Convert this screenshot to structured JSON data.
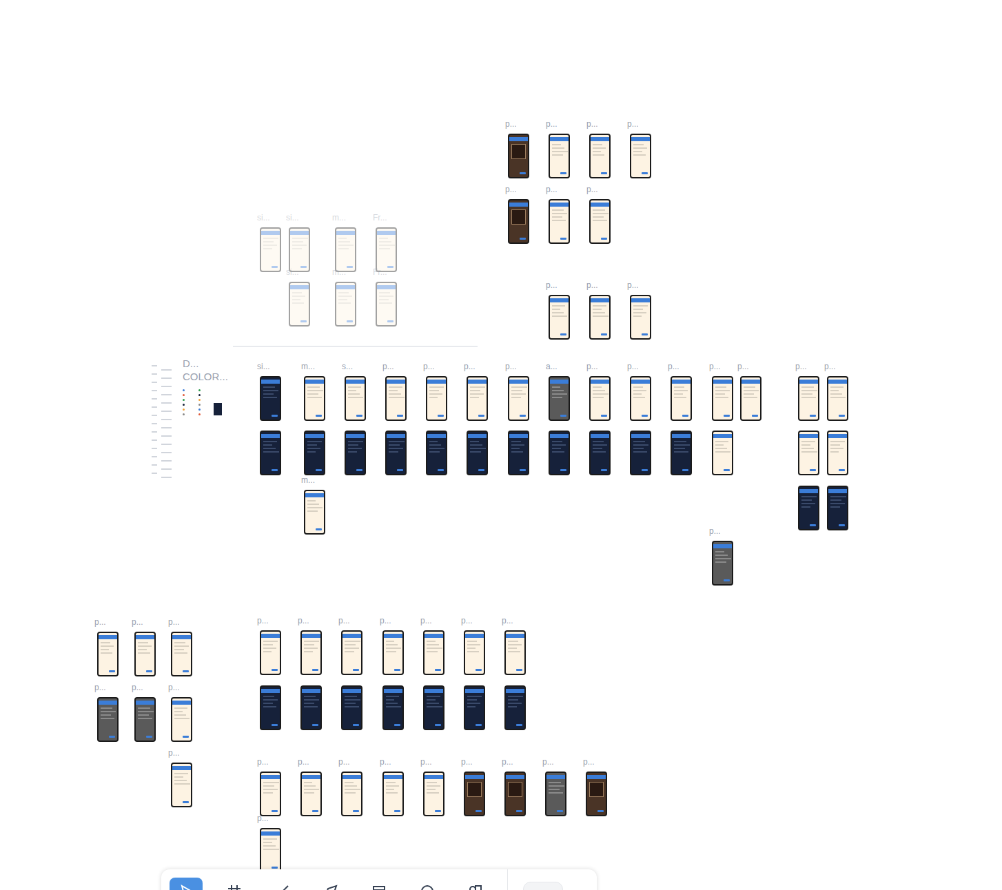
{
  "canvas": {
    "section_labels": [
      "D...",
      "COLOR..."
    ]
  },
  "frames": [
    {
      "label": "p...",
      "theme": "photo",
      "faded": false
    },
    {
      "label": "p...",
      "theme": "light",
      "faded": false
    },
    {
      "label": "p...",
      "theme": "light",
      "faded": false
    },
    {
      "label": "p...",
      "theme": "light",
      "faded": false
    },
    {
      "label": "p...",
      "theme": "photo",
      "faded": false
    },
    {
      "label": "p...",
      "theme": "light",
      "faded": false
    },
    {
      "label": "p...",
      "theme": "light",
      "faded": false
    },
    {
      "label": "p...",
      "theme": "light",
      "faded": false
    },
    {
      "label": "p...",
      "theme": "light",
      "faded": false
    },
    {
      "label": "p...",
      "theme": "light",
      "faded": false
    },
    {
      "label": "si...",
      "theme": "light",
      "faded": true
    },
    {
      "label": "si...",
      "theme": "light",
      "faded": true
    },
    {
      "label": "m...",
      "theme": "light",
      "faded": true
    },
    {
      "label": "Fr...",
      "theme": "light",
      "faded": true
    },
    {
      "label": "si...",
      "theme": "light",
      "faded": true
    },
    {
      "label": "m...",
      "theme": "light",
      "faded": true
    },
    {
      "label": "Fr...",
      "theme": "light",
      "faded": true
    },
    {
      "label": "si...",
      "theme": "dark",
      "faded": false
    },
    {
      "label": "m...",
      "theme": "light",
      "faded": false
    },
    {
      "label": "s...",
      "theme": "light",
      "faded": false
    },
    {
      "label": "p...",
      "theme": "light",
      "faded": false
    },
    {
      "label": "p...",
      "theme": "light",
      "faded": false
    },
    {
      "label": "p...",
      "theme": "light",
      "faded": false
    },
    {
      "label": "p...",
      "theme": "light",
      "faded": false
    },
    {
      "label": "a...",
      "theme": "gray",
      "faded": false
    },
    {
      "label": "p...",
      "theme": "light",
      "faded": false
    },
    {
      "label": "p...",
      "theme": "light",
      "faded": false
    },
    {
      "label": "p...",
      "theme": "light",
      "faded": false
    },
    {
      "label": "p...",
      "theme": "light",
      "faded": false
    },
    {
      "label": "p...",
      "theme": "light",
      "faded": false
    },
    {
      "label": "p...",
      "theme": "light",
      "faded": false
    },
    {
      "label": "p...",
      "theme": "light",
      "faded": false
    },
    {
      "theme": "dark",
      "faded": false
    },
    {
      "theme": "dark",
      "faded": false
    },
    {
      "theme": "dark",
      "faded": false
    },
    {
      "theme": "dark",
      "faded": false
    },
    {
      "theme": "dark",
      "faded": false
    },
    {
      "theme": "dark",
      "faded": false
    },
    {
      "theme": "dark",
      "faded": false
    },
    {
      "theme": "dark",
      "faded": false
    },
    {
      "theme": "dark",
      "faded": false
    },
    {
      "theme": "dark",
      "faded": false
    },
    {
      "theme": "dark",
      "faded": false
    },
    {
      "theme": "light",
      "faded": false
    },
    {
      "theme": "light",
      "faded": false
    },
    {
      "theme": "light",
      "faded": false
    },
    {
      "theme": "dark",
      "faded": false
    },
    {
      "theme": "dark",
      "faded": false
    },
    {
      "label": "m...",
      "theme": "light",
      "faded": false
    },
    {
      "label": "p...",
      "theme": "gray",
      "faded": false
    },
    {
      "label": "p...",
      "theme": "light",
      "faded": false
    },
    {
      "label": "p...",
      "theme": "light",
      "faded": false
    },
    {
      "label": "p...",
      "theme": "light",
      "faded": false
    },
    {
      "label": "p...",
      "theme": "gray",
      "faded": false
    },
    {
      "label": "p...",
      "theme": "gray",
      "faded": false
    },
    {
      "label": "p...",
      "theme": "light",
      "faded": false
    },
    {
      "label": "p...",
      "theme": "light",
      "faded": false
    },
    {
      "label": "p...",
      "theme": "light",
      "faded": false
    },
    {
      "label": "p...",
      "theme": "light",
      "faded": false
    },
    {
      "label": "p...",
      "theme": "light",
      "faded": false
    },
    {
      "label": "p...",
      "theme": "light",
      "faded": false
    },
    {
      "label": "p...",
      "theme": "light",
      "faded": false
    },
    {
      "label": "p...",
      "theme": "light",
      "faded": false
    },
    {
      "label": "p...",
      "theme": "light",
      "faded": false
    },
    {
      "theme": "dark",
      "faded": false
    },
    {
      "theme": "dark",
      "faded": false
    },
    {
      "theme": "dark",
      "faded": false
    },
    {
      "theme": "dark",
      "faded": false
    },
    {
      "theme": "dark",
      "faded": false
    },
    {
      "theme": "dark",
      "faded": false
    },
    {
      "theme": "dark",
      "faded": false
    },
    {
      "label": "p...",
      "theme": "light",
      "faded": false
    },
    {
      "label": "p...",
      "theme": "light",
      "faded": false
    },
    {
      "label": "p...",
      "theme": "light",
      "faded": false
    },
    {
      "label": "p...",
      "theme": "light",
      "faded": false
    },
    {
      "label": "p...",
      "theme": "light",
      "faded": false
    },
    {
      "label": "p...",
      "theme": "photo",
      "faded": false
    },
    {
      "label": "p...",
      "theme": "photo",
      "faded": false
    },
    {
      "label": "p...",
      "theme": "gray",
      "faded": false
    },
    {
      "label": "p...",
      "theme": "photo",
      "faded": false
    },
    {
      "label": "p...",
      "theme": "light",
      "faded": false
    }
  ],
  "toolbar": {
    "tools": [
      {
        "kind": "move",
        "selected": true
      },
      {
        "kind": "frame",
        "selected": false
      },
      {
        "kind": "line",
        "selected": false
      },
      {
        "kind": "pen",
        "selected": false
      },
      {
        "kind": "table",
        "selected": false
      },
      {
        "kind": "comment",
        "selected": false
      },
      {
        "kind": "shapes",
        "selected": false
      }
    ],
    "toggle": {
      "on": false
    }
  }
}
